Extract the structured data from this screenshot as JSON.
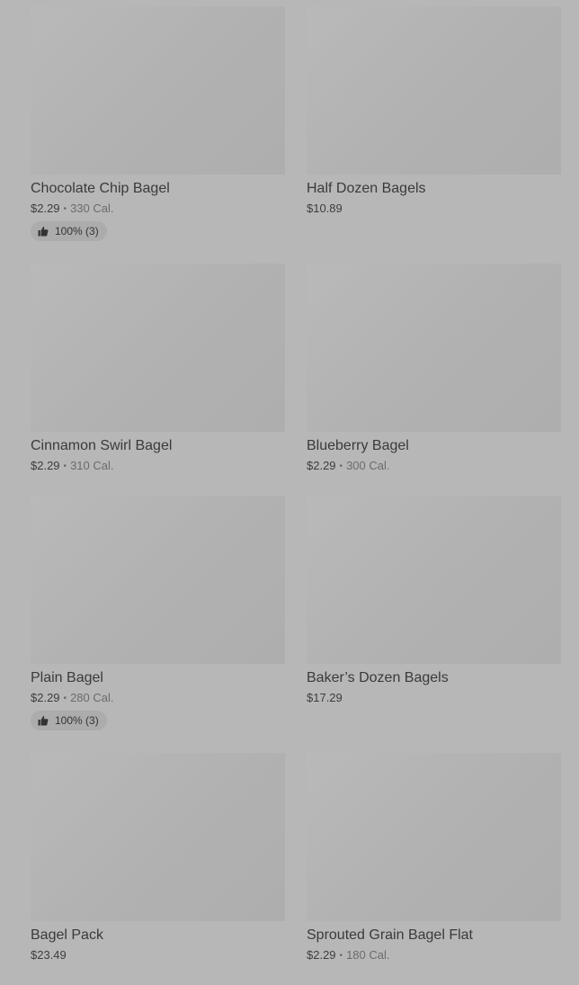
{
  "menu": {
    "items": [
      {
        "name": "Chocolate Chip Bagel",
        "price": "$2.29",
        "calories": "330 Cal.",
        "rating": "100% (3)"
      },
      {
        "name": "Half Dozen Bagels",
        "price": "$10.89"
      },
      {
        "name": "Cinnamon Swirl Bagel",
        "price": "$2.29",
        "calories": "310 Cal."
      },
      {
        "name": "Blueberry Bagel",
        "price": "$2.29",
        "calories": "300 Cal."
      },
      {
        "name": "Plain Bagel",
        "price": "$2.29",
        "calories": "280 Cal.",
        "rating": "100% (3)"
      },
      {
        "name": "Baker’s Dozen Bagels",
        "price": "$17.29"
      },
      {
        "name": "Bagel Pack",
        "price": "$23.49"
      },
      {
        "name": "Sprouted Grain Bagel Flat",
        "price": "$2.29",
        "calories": "180 Cal."
      }
    ],
    "separator": "•",
    "rating_icon": "thumbs-up-icon"
  }
}
